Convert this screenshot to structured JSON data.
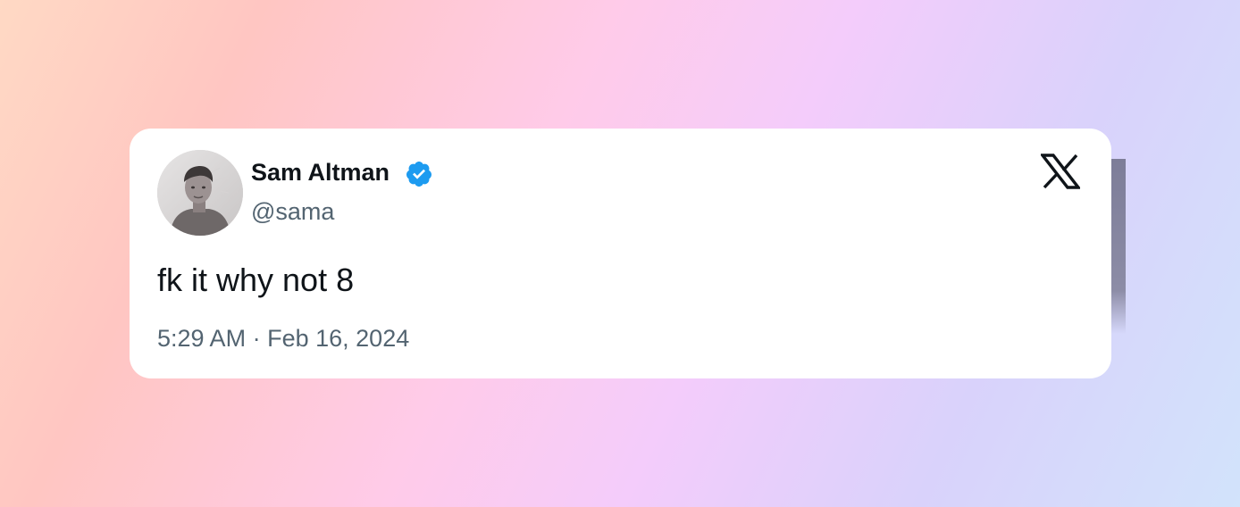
{
  "background": {
    "gradient_colors": [
      "#ffd9c4",
      "#ffc6c2",
      "#ffcbe9",
      "#f4ccfb",
      "#d9d2fb",
      "#d2e3fb"
    ]
  },
  "tweet": {
    "author": {
      "display_name": "Sam Altman",
      "handle": "@sama",
      "verified": true,
      "verified_color": "#1d9bf0",
      "avatar": "avatar-photo"
    },
    "text": "fk it why not 8",
    "time": "5:29 AM",
    "separator": "·",
    "date": "Feb 16, 2024",
    "platform_icon": "x-logo-icon"
  }
}
